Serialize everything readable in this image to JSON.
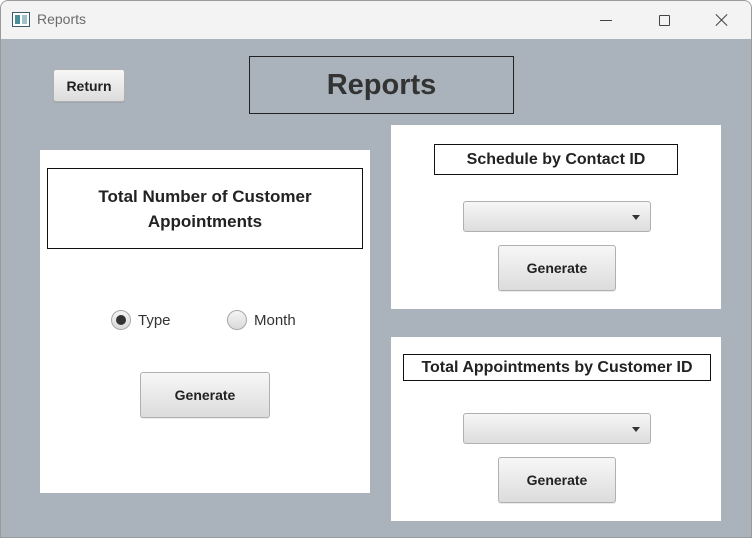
{
  "window": {
    "title": "Reports",
    "controls": {
      "minimize": "minimize-icon",
      "maximize": "maximize-icon",
      "close": "close-icon"
    }
  },
  "header": {
    "return_label": "Return",
    "page_title": "Reports"
  },
  "left_panel": {
    "heading": "Total Number of Customer Appointments",
    "radio_options": [
      {
        "label": "Type",
        "selected": true
      },
      {
        "label": "Month",
        "selected": false
      }
    ],
    "generate_label": "Generate"
  },
  "contact_panel": {
    "heading": "Schedule by Contact ID",
    "combo_value": "",
    "generate_label": "Generate"
  },
  "customer_panel": {
    "heading": "Total Appointments by Customer ID",
    "combo_value": "",
    "generate_label": "Generate"
  },
  "colors": {
    "background": "#aab2bc",
    "panel": "#ffffff",
    "titlebar": "#f3f3f3"
  }
}
